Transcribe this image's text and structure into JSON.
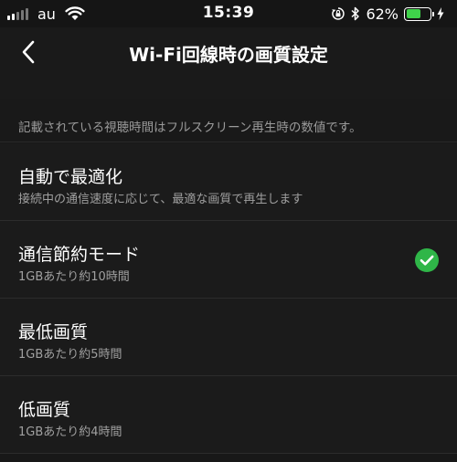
{
  "status_bar": {
    "carrier": "au",
    "time": "15:39",
    "battery_percent": "62%",
    "battery_level": 0.62,
    "battery_color": "#3fd24a",
    "icons": [
      "signal-icon",
      "wifi-icon",
      "orientation-lock-icon",
      "bluetooth-icon",
      "battery-icon",
      "charging-icon"
    ]
  },
  "nav": {
    "title": "Wi-Fi回線時の画質設定",
    "back_icon": "chevron-left-icon"
  },
  "note": "記載されている視聴時間はフルスクリーン再生時の数値です。",
  "options": [
    {
      "title": "自動で最適化",
      "subtitle": "接続中の通信速度に応じて、最適な画質で再生します",
      "selected": false
    },
    {
      "title": "通信節約モード",
      "subtitle": "1GBあたり約10時間",
      "selected": true
    },
    {
      "title": "最低画質",
      "subtitle": "1GBあたり約5時間",
      "selected": false
    },
    {
      "title": "低画質",
      "subtitle": "1GBあたり約4時間",
      "selected": false
    }
  ],
  "colors": {
    "background": "#181818",
    "accent_check": "#2fb648",
    "secondary_text": "#a0a0a0"
  }
}
